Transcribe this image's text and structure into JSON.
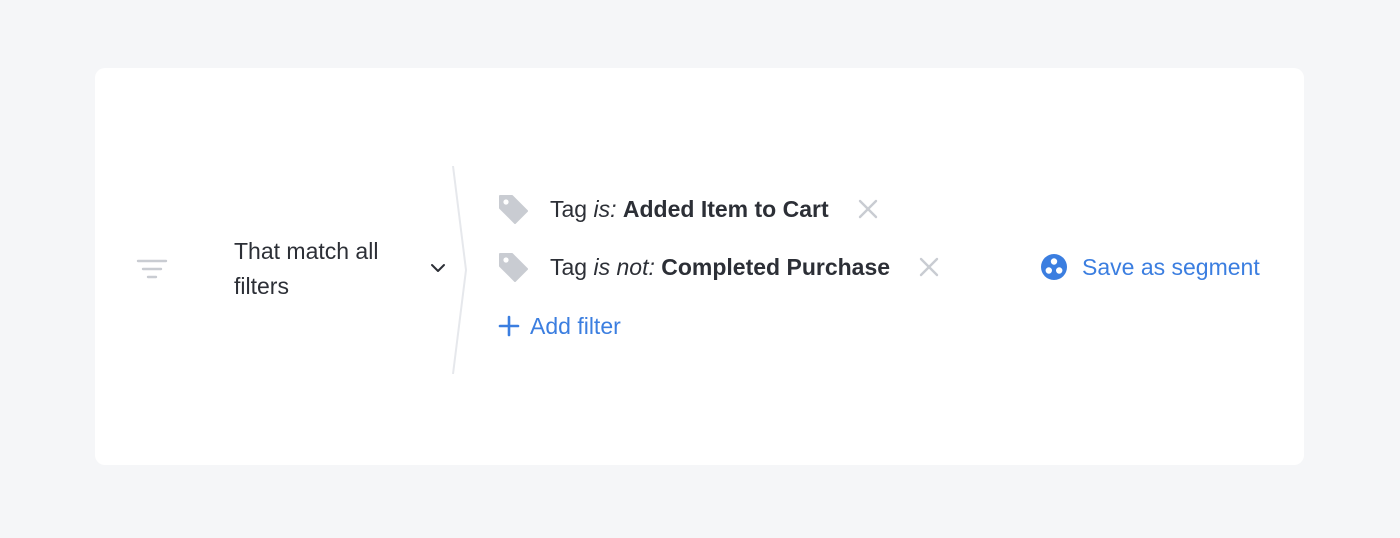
{
  "colors": {
    "background": "#f5f6f8",
    "card": "#ffffff",
    "text": "#2c2f36",
    "accent": "#3b7ee0",
    "icon_muted": "#c9ccd2"
  },
  "match_selector": {
    "label": "That match all filters",
    "icon": "filter-icon",
    "dropdown_icon": "chevron-down-icon"
  },
  "filters": [
    {
      "icon": "tag-icon",
      "field": "Tag",
      "operator": "is:",
      "value": "Added Item to Cart",
      "remove_icon": "close-icon"
    },
    {
      "icon": "tag-icon",
      "field": "Tag",
      "operator": "is not:",
      "value": "Completed Purchase",
      "remove_icon": "close-icon"
    }
  ],
  "add_filter": {
    "icon": "plus-icon",
    "label": "Add filter"
  },
  "save_segment": {
    "icon": "segment-icon",
    "label": "Save as segment"
  }
}
